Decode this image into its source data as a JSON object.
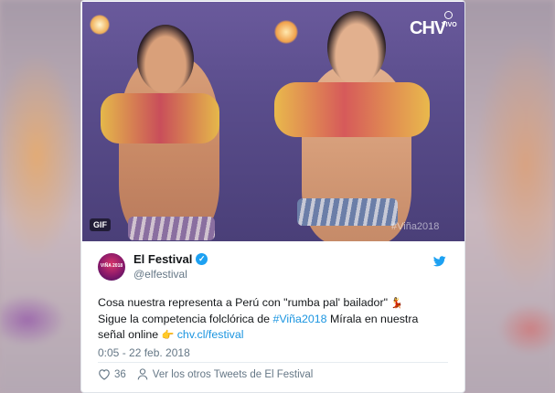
{
  "media": {
    "gif_label": "GIF",
    "broadcaster_logo": "CHV",
    "live_label": "VIVO",
    "hashtag_watermark": "#Viña2018"
  },
  "author": {
    "avatar_text": "VIÑA 2018",
    "display_name": "El Festival",
    "handle": "@elfestival",
    "verified_icon": "verified-badge-icon"
  },
  "tweet": {
    "line1_text": "Cosa nuestra representa a Perú con \"rumba pal' bailador\" ",
    "line1_emoji": "💃",
    "line2_text": "Sigue la competencia folclórica de ",
    "line2_hashtag": "#Viña2018",
    "line2_rest": " Mírala en nuestra",
    "line3_text": "señal online ",
    "line3_emoji": "👉",
    "line3_link": "chv.cl/festival",
    "timestamp": "0:05 - 22 feb. 2018"
  },
  "actions": {
    "likes": "36",
    "more_tweets": "Ver los otros Tweets de El Festival"
  },
  "colors": {
    "link": "#1b95e0",
    "twitter_blue": "#1da1f2",
    "text": "#14171a",
    "muted": "#657786"
  }
}
